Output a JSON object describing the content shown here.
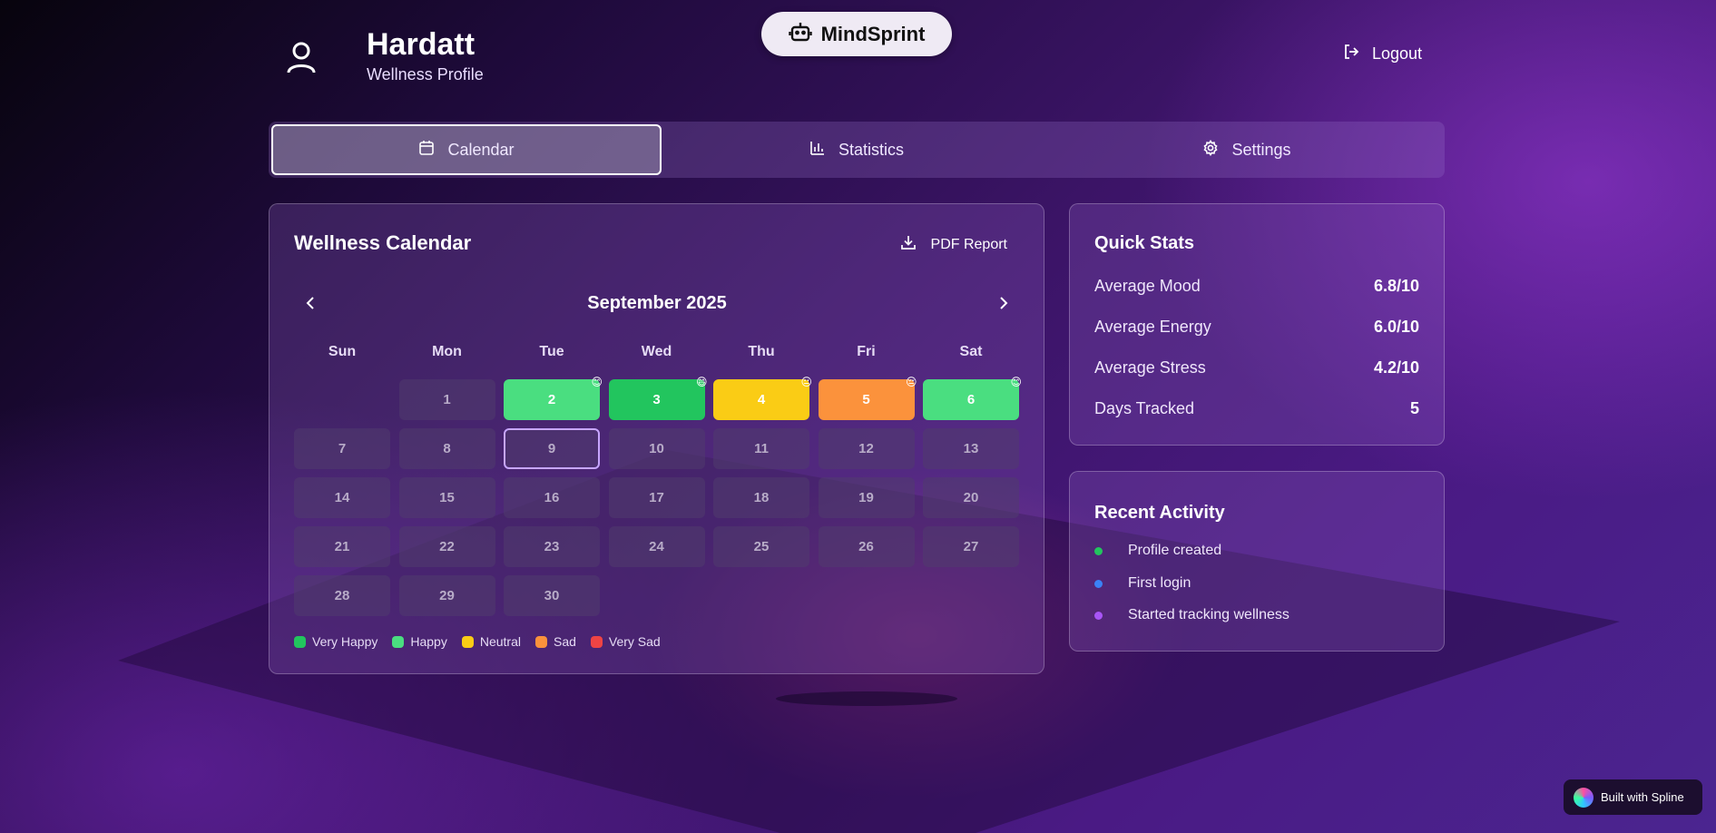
{
  "header": {
    "user_name": "Hardatt",
    "user_subtitle": "Wellness Profile",
    "brand_name": "MindSprint",
    "logout_label": "Logout"
  },
  "tabs": [
    {
      "label": "Calendar",
      "icon": "calendar-icon",
      "active": true
    },
    {
      "label": "Statistics",
      "icon": "bar-chart-icon",
      "active": false
    },
    {
      "label": "Settings",
      "icon": "gear-icon",
      "active": false
    }
  ],
  "calendar": {
    "title": "Wellness Calendar",
    "pdf_label": "PDF Report",
    "month_label": "September 2025",
    "weekdays": [
      "Sun",
      "Mon",
      "Tue",
      "Wed",
      "Thu",
      "Fri",
      "Sat"
    ],
    "leading_blank_days": 1,
    "days_in_month": 30,
    "today": 9,
    "entries": {
      "2": {
        "mood": "happy",
        "emoji": "😊"
      },
      "3": {
        "mood": "very_happy",
        "emoji": "😄"
      },
      "4": {
        "mood": "neutral",
        "emoji": "😐"
      },
      "5": {
        "mood": "sad",
        "emoji": "😔"
      },
      "6": {
        "mood": "happy",
        "emoji": "😊"
      }
    },
    "legend": [
      {
        "key": "very_happy",
        "label": "Very Happy",
        "color": "#22c55e"
      },
      {
        "key": "happy",
        "label": "Happy",
        "color": "#4ade80"
      },
      {
        "key": "neutral",
        "label": "Neutral",
        "color": "#facc15"
      },
      {
        "key": "sad",
        "label": "Sad",
        "color": "#fb923c"
      },
      {
        "key": "very_sad",
        "label": "Very Sad",
        "color": "#ef4444"
      }
    ]
  },
  "quick_stats": {
    "title": "Quick Stats",
    "rows": [
      {
        "label": "Average Mood",
        "value": "6.8/10"
      },
      {
        "label": "Average Energy",
        "value": "6.0/10"
      },
      {
        "label": "Average Stress",
        "value": "4.2/10"
      },
      {
        "label": "Days Tracked",
        "value": "5"
      }
    ]
  },
  "recent_activity": {
    "title": "Recent Activity",
    "items": [
      {
        "label": "Profile created",
        "color": "#22c55e"
      },
      {
        "label": "First login",
        "color": "#3b82f6"
      },
      {
        "label": "Started tracking wellness",
        "color": "#a855f7"
      }
    ]
  },
  "badge": {
    "label": "Built with Spline"
  }
}
